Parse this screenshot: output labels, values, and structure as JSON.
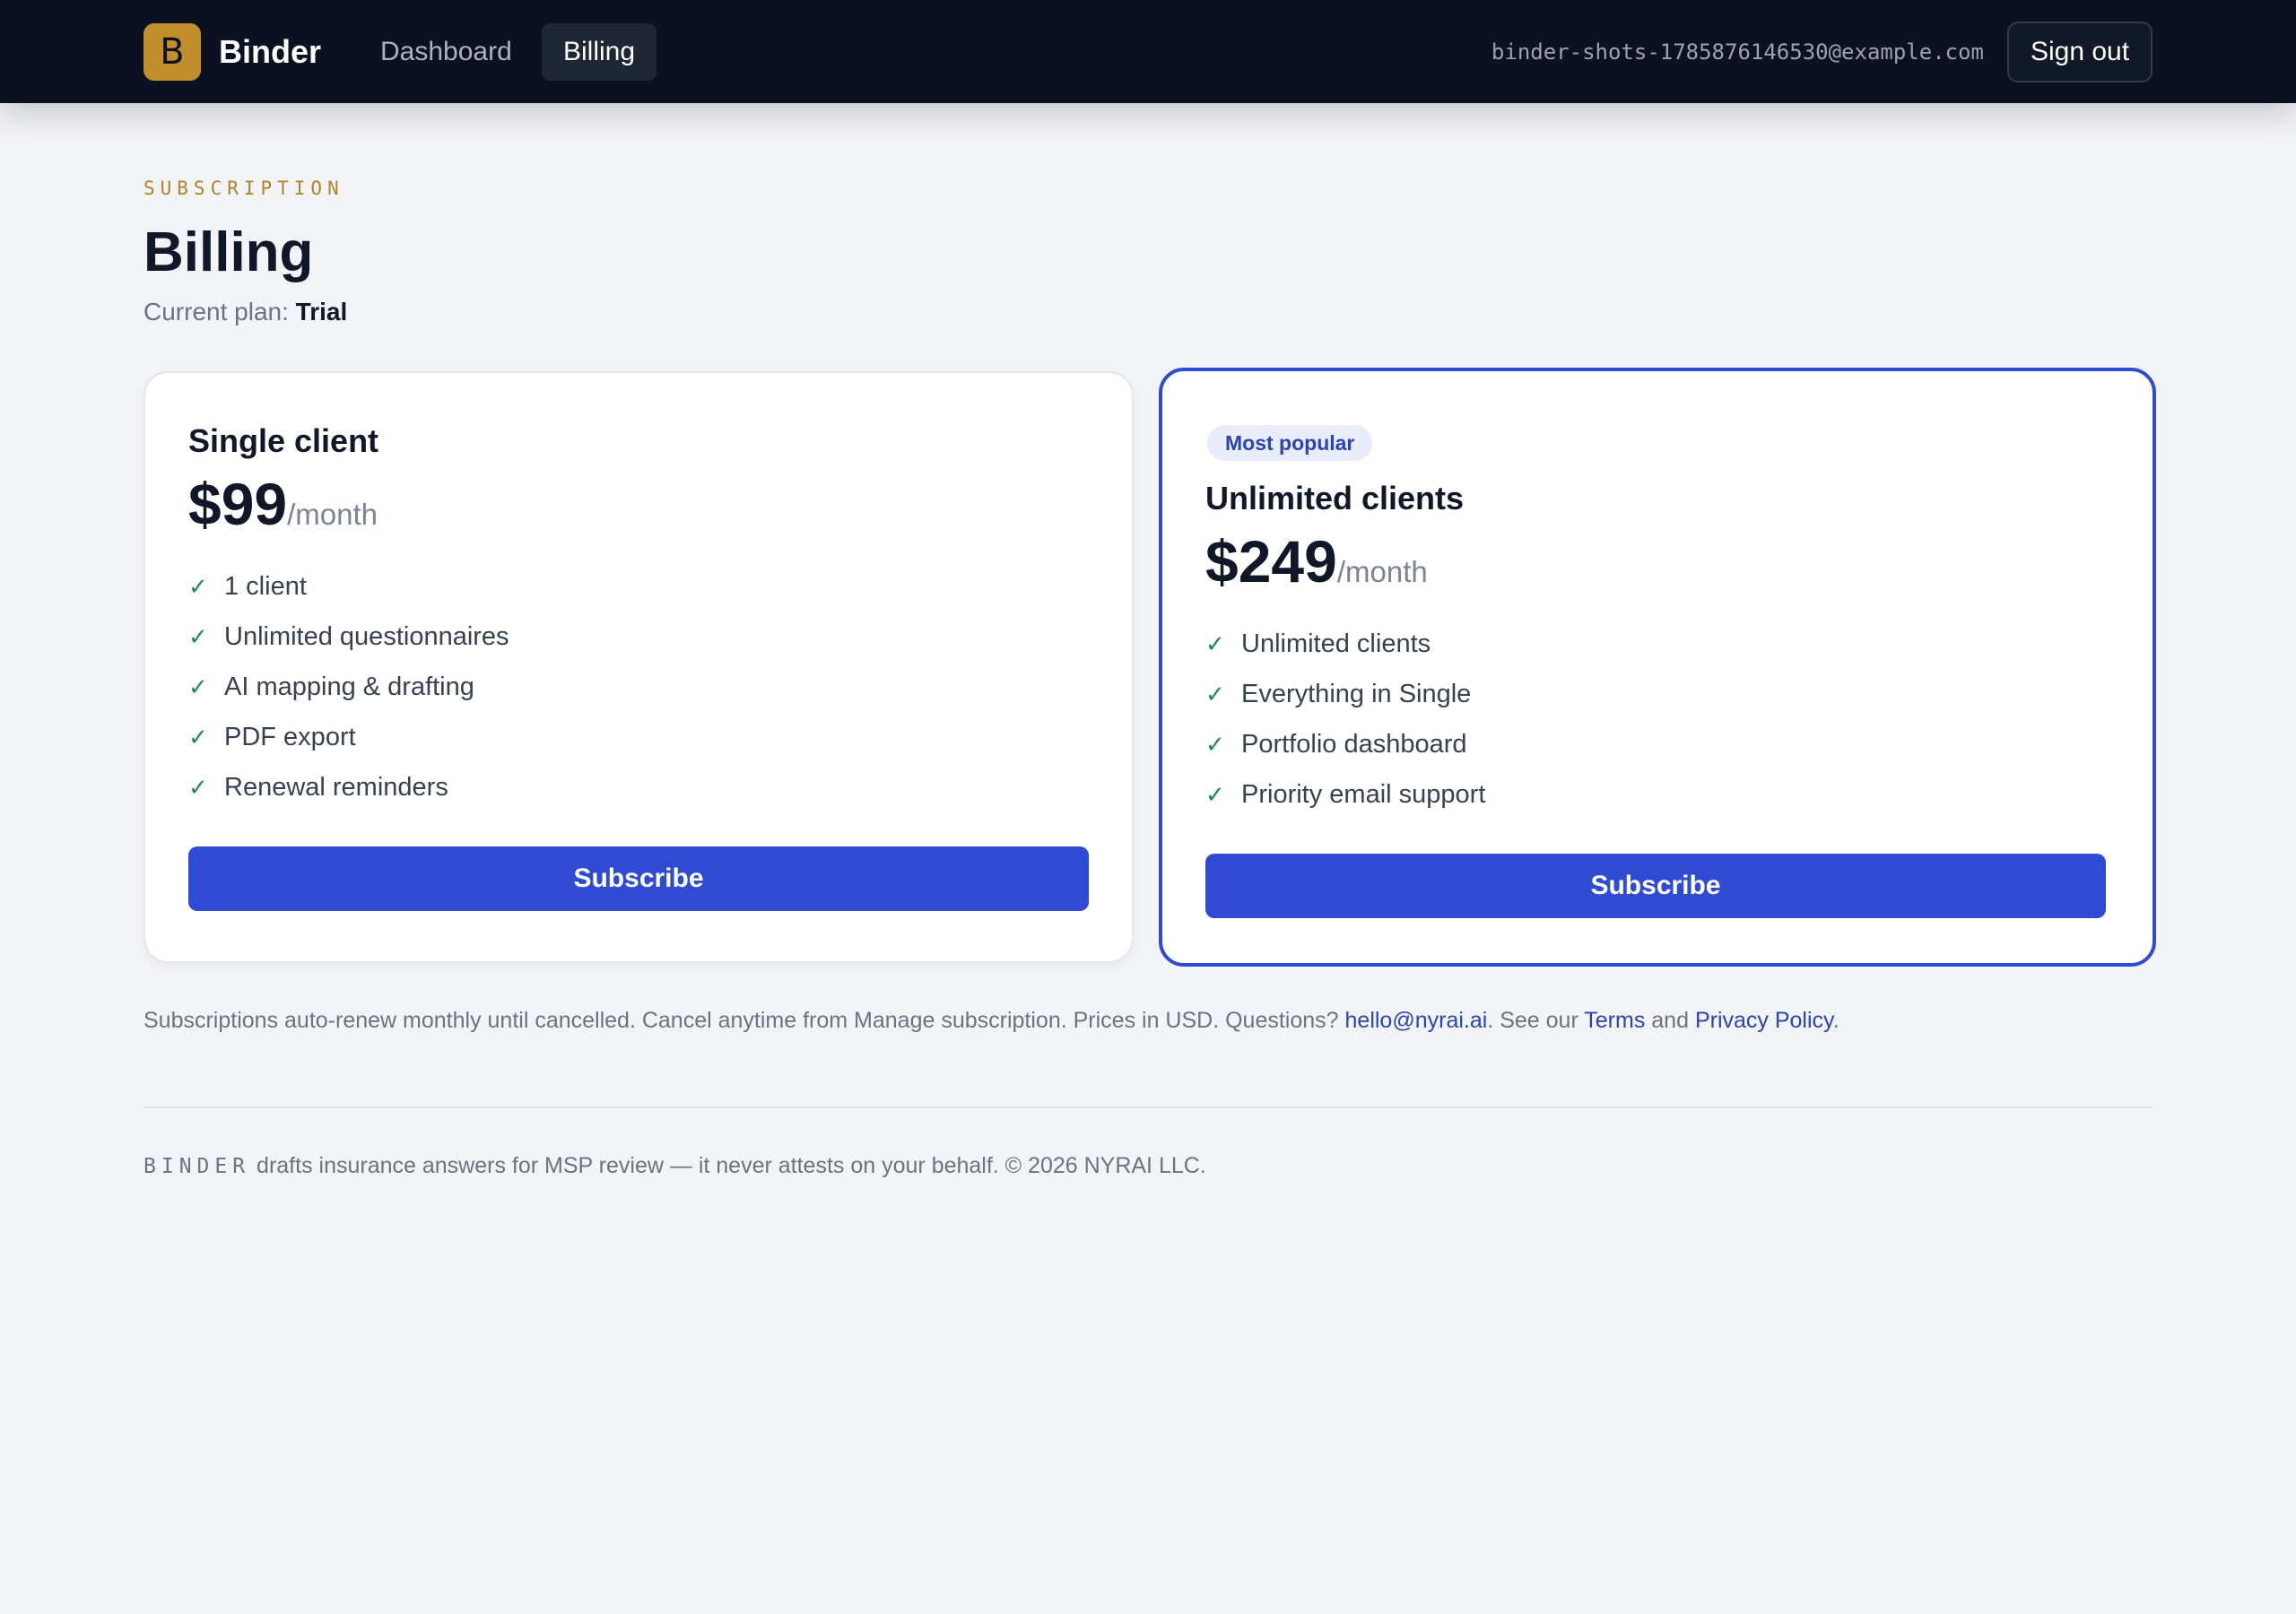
{
  "colors": {
    "nav_bg": "#0b1120",
    "brand_gold": "#c08f2c",
    "accent_blue": "#2f4bd3",
    "check_green": "#1f8a4c",
    "page_bg": "#f3f4f7"
  },
  "nav": {
    "logo_letter": "B",
    "brand": "Binder",
    "links": [
      {
        "label": "Dashboard",
        "active": false
      },
      {
        "label": "Billing",
        "active": true
      }
    ],
    "user_email": "binder-shots-1785876146530@example.com",
    "sign_out": "Sign out"
  },
  "header": {
    "eyebrow": "SUBSCRIPTION",
    "title": "Billing",
    "current_plan_label": "Current plan:",
    "current_plan_value": "Trial"
  },
  "plans": [
    {
      "name": "Single client",
      "price": "$99",
      "period": "/month",
      "features": [
        "1 client",
        "Unlimited questionnaires",
        "AI mapping & drafting",
        "PDF export",
        "Renewal reminders"
      ],
      "cta": "Subscribe"
    },
    {
      "badge": "Most popular",
      "name": "Unlimited clients",
      "price": "$249",
      "period": "/month",
      "features": [
        "Unlimited clients",
        "Everything in Single",
        "Portfolio dashboard",
        "Priority email support"
      ],
      "cta": "Subscribe"
    }
  ],
  "notice": {
    "text_before": "Subscriptions auto-renew monthly until cancelled. Cancel anytime from Manage subscription. Prices in USD. Questions? ",
    "email_link": "hello@nyrai.ai",
    "text_middle": ". See our ",
    "terms_link": "Terms",
    "and_text": " and ",
    "privacy_link": "Privacy Policy",
    "text_end": "."
  },
  "footer": {
    "brand_mono": "BINDER",
    "text": " drafts insurance answers for MSP review — it never attests on your behalf. © 2026 NYRAI LLC."
  },
  "icons": {
    "check": "check-icon"
  }
}
